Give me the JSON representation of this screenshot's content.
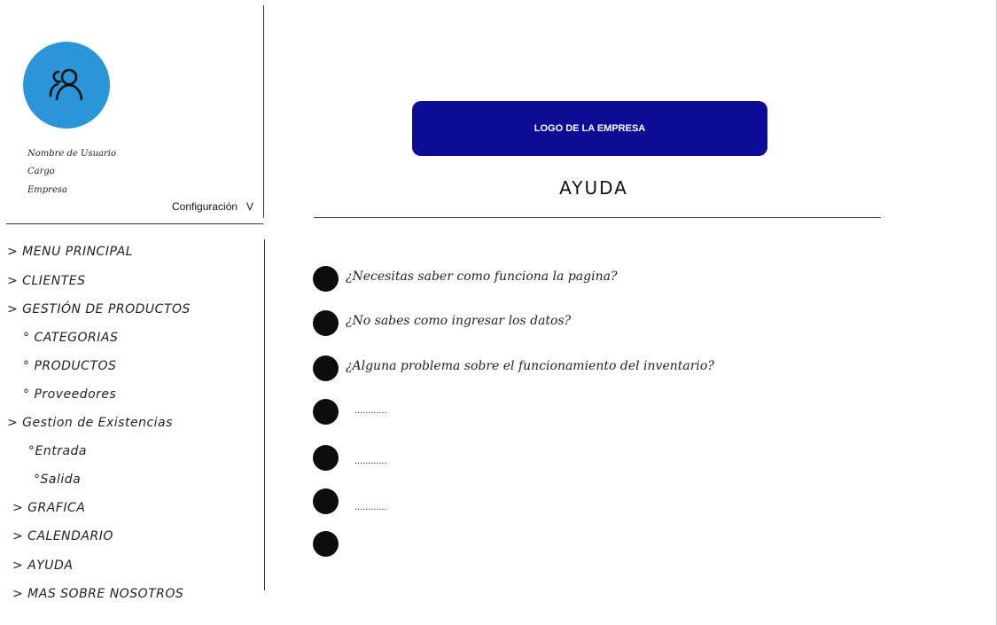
{
  "user": {
    "name": "Nombre de Usuario",
    "role": "Cargo",
    "company": "Empresa",
    "config_label": "Configuración   V"
  },
  "nav": {
    "items": [
      {
        "label": "> MENU PRINCIPAL"
      },
      {
        "label": "> CLIENTES"
      },
      {
        "label": "> GESTIÓN DE PRODUCTOS"
      },
      {
        "label": "° CATEGORIAS"
      },
      {
        "label": "° PRODUCTOS"
      },
      {
        "label": "° Proveedores"
      },
      {
        "label": "> Gestion de Existencias"
      },
      {
        "label": "°Entrada"
      },
      {
        "label": "°Salida"
      },
      {
        "label": "> GRAFICA"
      },
      {
        "label": "> CALENDARIO"
      },
      {
        "label": "> AYUDA"
      },
      {
        "label": "> MAS SOBRE NOSOTROS"
      }
    ]
  },
  "main": {
    "logo_label": "LOGO DE LA EMPRESA",
    "title": "AYUDA",
    "help_items": [
      {
        "label": "¿Necesitas saber como funciona la pagina?"
      },
      {
        "label": "¿No sabes como ingresar los datos?"
      },
      {
        "label": "¿Alguna problema sobre el funcionamiento del inventario?"
      },
      {
        "label": "............"
      },
      {
        "label": "............"
      },
      {
        "label": "............"
      },
      {
        "label": ""
      }
    ]
  },
  "colors": {
    "avatar": "#2b95d9",
    "logo_bg": "#0c0c97",
    "bullet": "#0d0d0d"
  },
  "icons": {
    "avatar": "users-icon"
  }
}
